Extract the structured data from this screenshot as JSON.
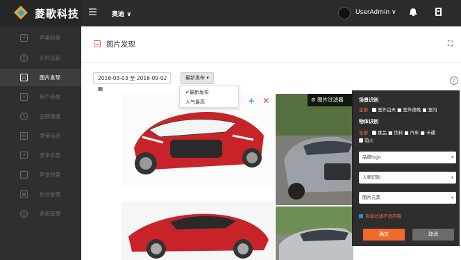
{
  "topbar": {
    "logo_text": "菱歌科技",
    "brand_select": "奥迪 ∨",
    "user_name": "UserAdmin ∨"
  },
  "sidebar": {
    "items": [
      {
        "label": "声量趋势",
        "icon": "bar-chart-icon",
        "active": false
      },
      {
        "label": "实时追踪",
        "icon": "globe-icon",
        "active": false
      },
      {
        "label": "图片发现",
        "icon": "picture-icon",
        "active": true
      },
      {
        "label": "用户画像",
        "icon": "user-profile-icon",
        "active": false
      },
      {
        "label": "品牌健康",
        "icon": "health-icon",
        "active": false
      },
      {
        "label": "营销活动",
        "icon": "briefcase-icon",
        "active": false
      },
      {
        "label": "竞争态势",
        "icon": "competition-icon",
        "active": false
      },
      {
        "label": "声誉预警",
        "icon": "shield-icon",
        "active": false
      },
      {
        "label": "后台管理",
        "icon": "grid-icon",
        "active": false
      },
      {
        "label": "系统管理",
        "icon": "settings-icon",
        "active": false
      }
    ]
  },
  "main": {
    "title": "图片发现",
    "date_range": "2016-08-03 至 2016-09-02 ▦",
    "sort_button": "最新发布 ▾",
    "sort_options": [
      "最新发布",
      "人气最高"
    ],
    "sort_selected_mark": "✔",
    "help": "?",
    "card_plus": "+",
    "card_close": "✕"
  },
  "filter": {
    "tab_label": "图片过滤器",
    "scene_title": "场景识别",
    "scene_all": "全部",
    "scene_options": "室外白天 ■ 室外夜晚 ■ 室内",
    "object_title": "物体识别",
    "object_all": "全部",
    "object_options_1": "食品 ■ 饮料 ■ 汽车 ■ 卡通",
    "object_options_2": "馅火",
    "select_logo": "品牌logo",
    "select_person": "人物识别",
    "select_element": "图片元素",
    "auto_filter": "自动过滤不良内容",
    "ok_label": "确定",
    "cancel_label": "取消"
  },
  "colors": {
    "topbar_bg": "#2b2b2b",
    "sidebar_bg": "#2f2f2f",
    "accent_orange": "#f06a2c",
    "plus_blue": "#4a90d9",
    "close_red": "#d9453a"
  }
}
